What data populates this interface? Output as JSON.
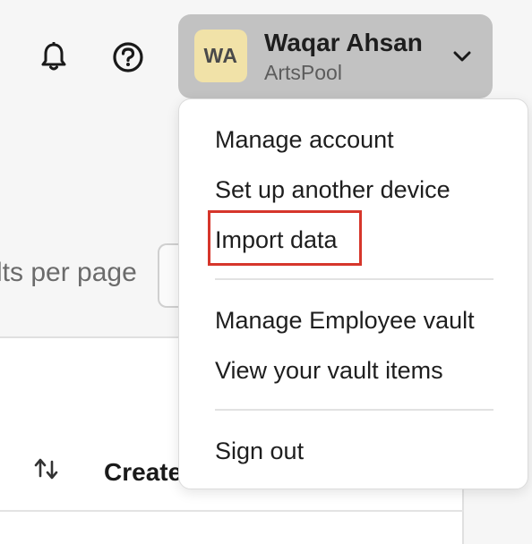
{
  "header": {
    "notifications_icon": "bell-icon",
    "help_icon": "question-circle-icon"
  },
  "account": {
    "initials": "WA",
    "name": "Waqar Ahsan",
    "organization": "ArtsPool",
    "avatar_color": "#f1e2a8",
    "expand_icon": "chevron-down-icon"
  },
  "menu": {
    "items": [
      {
        "label": "Manage account"
      },
      {
        "label": "Set up another device"
      },
      {
        "label": "Import data",
        "highlighted": true
      },
      {
        "label": "Manage Employee vault"
      },
      {
        "label": "View your vault items"
      },
      {
        "label": "Sign out"
      }
    ],
    "highlight_color": "#d6362b"
  },
  "page": {
    "results_per_page_label": "lts per page",
    "table": {
      "sort_icon": "sort-arrows-icon",
      "columns": [
        "Create"
      ]
    }
  }
}
